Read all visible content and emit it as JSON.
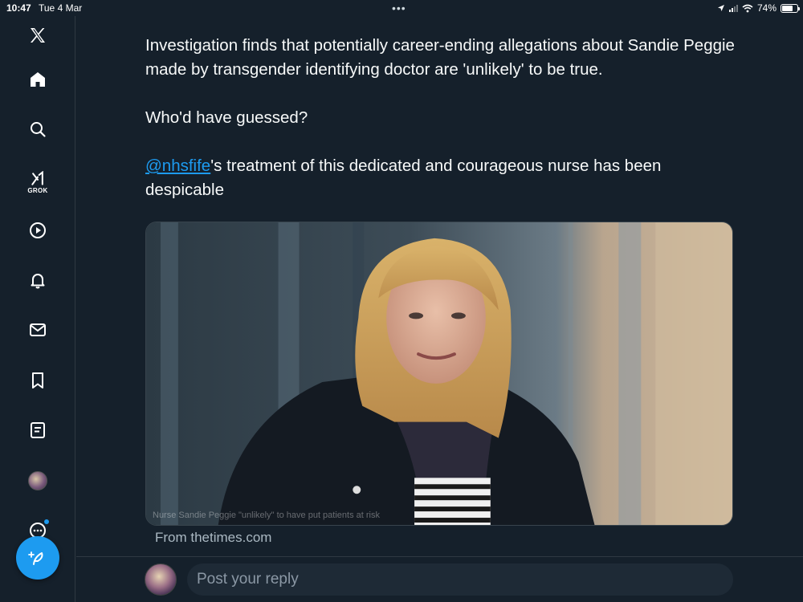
{
  "status_bar": {
    "time": "10:47",
    "date": "Tue 4 Mar",
    "dots": "•••",
    "battery": "74%",
    "battery_level": 0.74
  },
  "sidebar": {
    "items": [
      {
        "name": "x-logo-icon"
      },
      {
        "name": "home-icon"
      },
      {
        "name": "search-icon"
      },
      {
        "name": "grok-icon",
        "label": "GROK"
      },
      {
        "name": "video-play-icon"
      },
      {
        "name": "notifications-bell-icon"
      },
      {
        "name": "messages-mail-icon"
      },
      {
        "name": "bookmark-icon"
      },
      {
        "name": "lists-icon"
      },
      {
        "name": "profile-avatar"
      },
      {
        "name": "more-icon"
      }
    ],
    "compose_icon": "compose-feather-icon"
  },
  "tweet": {
    "paragraph1": "Investigation finds that potentially career-ending allegations about Sandie Peggie made by transgender identifying doctor are 'unlikely' to be true.",
    "paragraph2": "Who'd have guessed?",
    "mention": "@nhsfife",
    "paragraph3_rest": "'s treatment of this dedicated and courageous nurse has been despicable",
    "media_caption": "Nurse Sandie Peggie \"unlikely\" to have put patients at risk",
    "source": "From thetimes.com"
  },
  "reply": {
    "placeholder": "Post your reply"
  },
  "colors": {
    "background": "#15202b",
    "accent": "#1d9bf0",
    "text": "#f7f9f9",
    "muted": "#8b98a5"
  }
}
